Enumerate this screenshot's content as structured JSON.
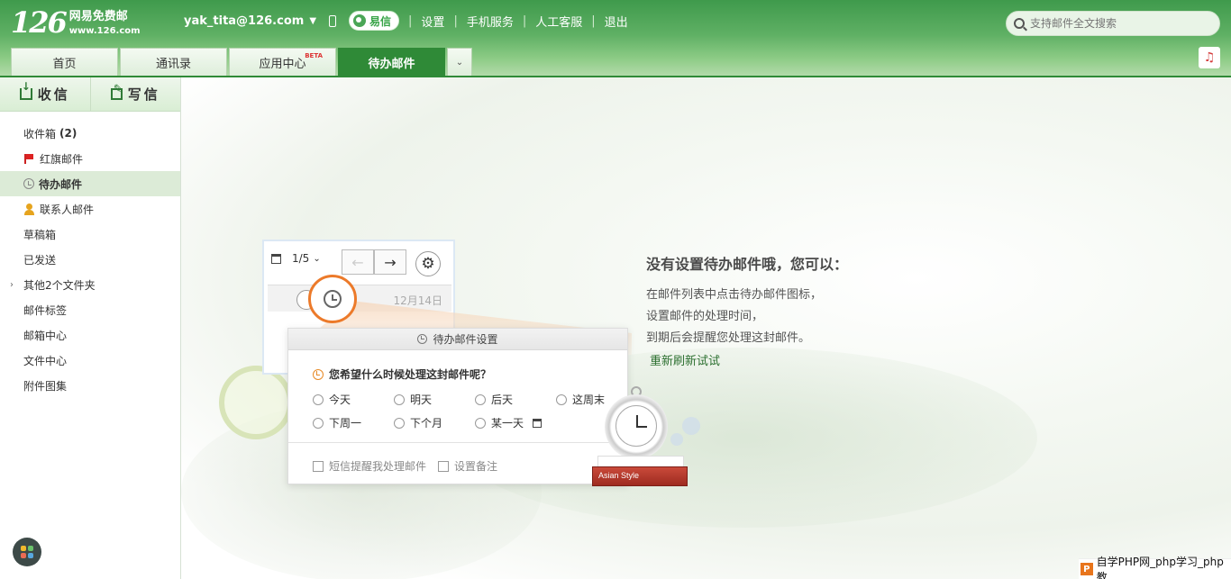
{
  "header": {
    "logo_number": "126",
    "logo_cn": "网易免费邮",
    "logo_url": "www.126.com",
    "user": "yak_tita@126.com",
    "yixin_label": "易信",
    "nav": [
      "设置",
      "手机服务",
      "人工客服",
      "退出"
    ],
    "search_placeholder": "支持邮件全文搜索",
    "tabs": [
      {
        "label": "首页",
        "active": false
      },
      {
        "label": "通讯录",
        "active": false
      },
      {
        "label": "应用中心",
        "active": false,
        "badge": "BETA"
      },
      {
        "label": "待办邮件",
        "active": true
      }
    ]
  },
  "sidebar": {
    "receive_label": "收信",
    "write_label": "写信",
    "folders": [
      {
        "label": "收件箱",
        "count": "(2)",
        "icon": "none"
      },
      {
        "label": "红旗邮件",
        "icon": "flag-icon"
      },
      {
        "label": "待办邮件",
        "icon": "clock-icon",
        "active": true
      },
      {
        "label": "联系人邮件",
        "icon": "contact-icon"
      },
      {
        "label": "草稿箱",
        "icon": "none"
      },
      {
        "label": "已发送",
        "icon": "none"
      },
      {
        "label": "其他2个文件夹",
        "icon": "none",
        "expandable": true
      },
      {
        "label": "邮件标签",
        "icon": "none"
      },
      {
        "label": "邮箱中心",
        "icon": "none"
      },
      {
        "label": "文件中心",
        "icon": "none"
      },
      {
        "label": "附件图集",
        "icon": "none"
      }
    ]
  },
  "illustration": {
    "page_indicator": "1/5",
    "mail_date": "12月14日",
    "dialog_title": "待办邮件设置",
    "question": "您希望什么时候处理这封邮件呢？",
    "options": [
      "今天",
      "明天",
      "后天",
      "这周末",
      "下周一",
      "下个月",
      "某一天"
    ],
    "checkbox_sms": "短信提醒我处理邮件",
    "checkbox_note": "设置备注",
    "book_label": "Asian Style"
  },
  "guide": {
    "title": "没有设置待办邮件哦，您可以：",
    "lines": [
      "在邮件列表中点击待办邮件图标，",
      "设置邮件的处理时间，",
      "到期后会提醒您处理这封邮件。"
    ],
    "refresh_link": "重新刷新试试"
  },
  "watermark": {
    "logo": "P",
    "text": "自学PHP网_php学习_php教"
  },
  "colors": {
    "brand_green": "#2f8a37",
    "accent_orange": "#ec7a2a",
    "link_green": "#2b6f2f"
  }
}
